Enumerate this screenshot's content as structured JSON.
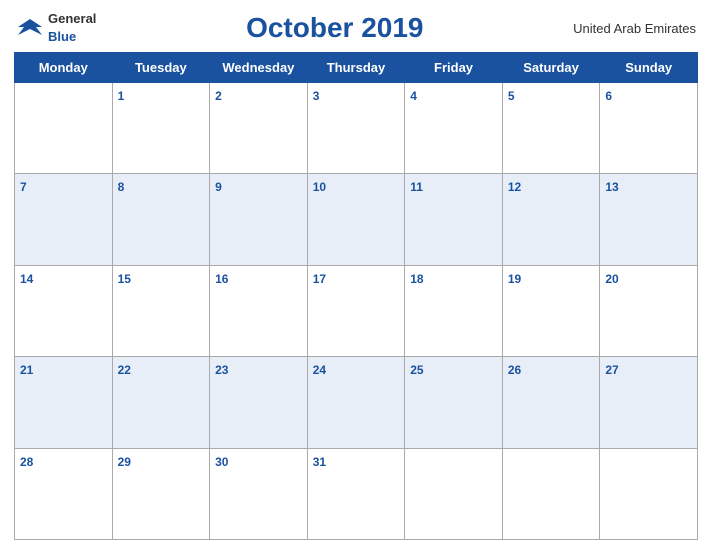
{
  "header": {
    "logo_general": "General",
    "logo_blue": "Blue",
    "title": "October 2019",
    "country": "United Arab Emirates"
  },
  "days_of_week": [
    "Monday",
    "Tuesday",
    "Wednesday",
    "Thursday",
    "Friday",
    "Saturday",
    "Sunday"
  ],
  "weeks": [
    [
      {
        "day": "",
        "empty": true
      },
      {
        "day": "1"
      },
      {
        "day": "2"
      },
      {
        "day": "3"
      },
      {
        "day": "4"
      },
      {
        "day": "5"
      },
      {
        "day": "6"
      }
    ],
    [
      {
        "day": "7"
      },
      {
        "day": "8"
      },
      {
        "day": "9"
      },
      {
        "day": "10"
      },
      {
        "day": "11"
      },
      {
        "day": "12"
      },
      {
        "day": "13"
      }
    ],
    [
      {
        "day": "14"
      },
      {
        "day": "15"
      },
      {
        "day": "16"
      },
      {
        "day": "17"
      },
      {
        "day": "18"
      },
      {
        "day": "19"
      },
      {
        "day": "20"
      }
    ],
    [
      {
        "day": "21"
      },
      {
        "day": "22"
      },
      {
        "day": "23"
      },
      {
        "day": "24"
      },
      {
        "day": "25"
      },
      {
        "day": "26"
      },
      {
        "day": "27"
      }
    ],
    [
      {
        "day": "28"
      },
      {
        "day": "29"
      },
      {
        "day": "30"
      },
      {
        "day": "31"
      },
      {
        "day": "",
        "empty": true
      },
      {
        "day": "",
        "empty": true
      },
      {
        "day": "",
        "empty": true
      }
    ]
  ],
  "colors": {
    "header_bg": "#1a52a0",
    "row_even": "#e8eef8",
    "row_odd": "#ffffff"
  }
}
